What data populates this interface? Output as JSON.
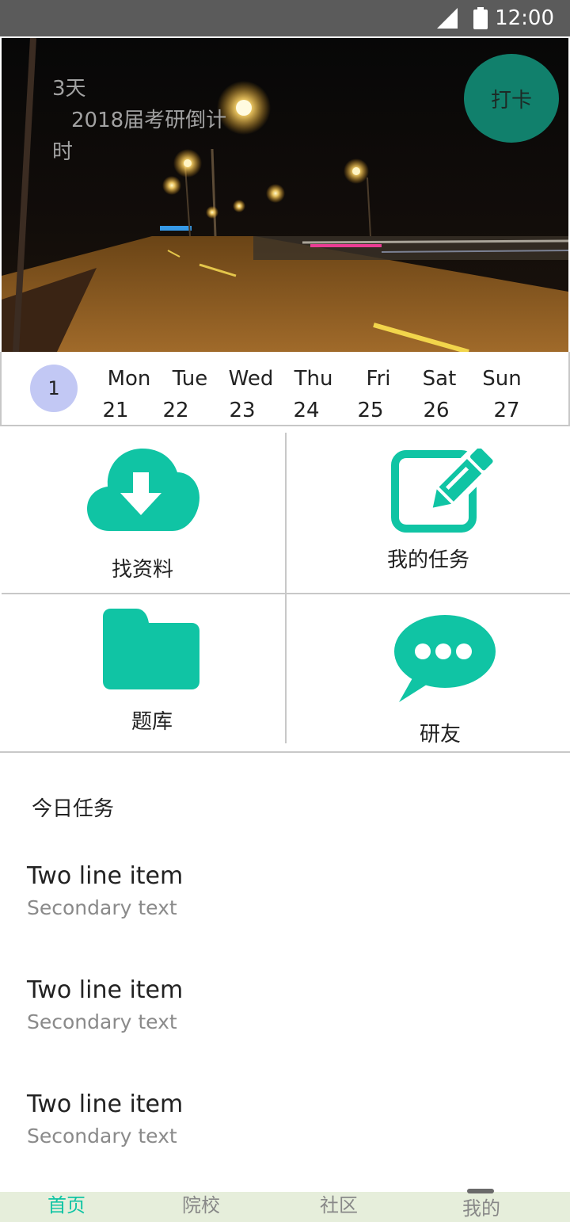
{
  "status_bar": {
    "time": "12:00",
    "icons": [
      "signal-icon",
      "battery-icon"
    ]
  },
  "hero": {
    "countdown_days": "3天",
    "countdown_title": "2018届考研倒计",
    "countdown_suffix": "时",
    "checkin_label": "打卡"
  },
  "week": {
    "week_number": "1",
    "days": [
      {
        "name": "Mon",
        "date": "21"
      },
      {
        "name": "Tue",
        "date": "22"
      },
      {
        "name": "Wed",
        "date": "23"
      },
      {
        "name": "Thu",
        "date": "24"
      },
      {
        "name": "Fri",
        "date": "25"
      },
      {
        "name": "Sat",
        "date": "26"
      },
      {
        "name": "Sun",
        "date": "27"
      }
    ]
  },
  "features": [
    {
      "label": "找资料",
      "icon": "cloud-download-icon"
    },
    {
      "label": "我的任务",
      "icon": "edit-icon"
    },
    {
      "label": "题库",
      "icon": "folder-icon"
    },
    {
      "label": "研友",
      "icon": "chat-bubble-icon"
    }
  ],
  "tasks": {
    "title": "今日任务",
    "items": [
      {
        "primary": "Two line item",
        "secondary": "Secondary text"
      },
      {
        "primary": "Two line item",
        "secondary": "Secondary text"
      },
      {
        "primary": "Two line item",
        "secondary": "Secondary text"
      }
    ]
  },
  "bottom_nav": {
    "items": [
      {
        "label": "首页",
        "active": true
      },
      {
        "label": "院校",
        "active": false
      },
      {
        "label": "社区",
        "active": false
      },
      {
        "label": "我的",
        "active": false
      }
    ]
  },
  "colors": {
    "accent": "#10c4a4",
    "checkin": "#11806c",
    "badge": "#c2c8f4",
    "nav_bg": "#e6eedb"
  }
}
